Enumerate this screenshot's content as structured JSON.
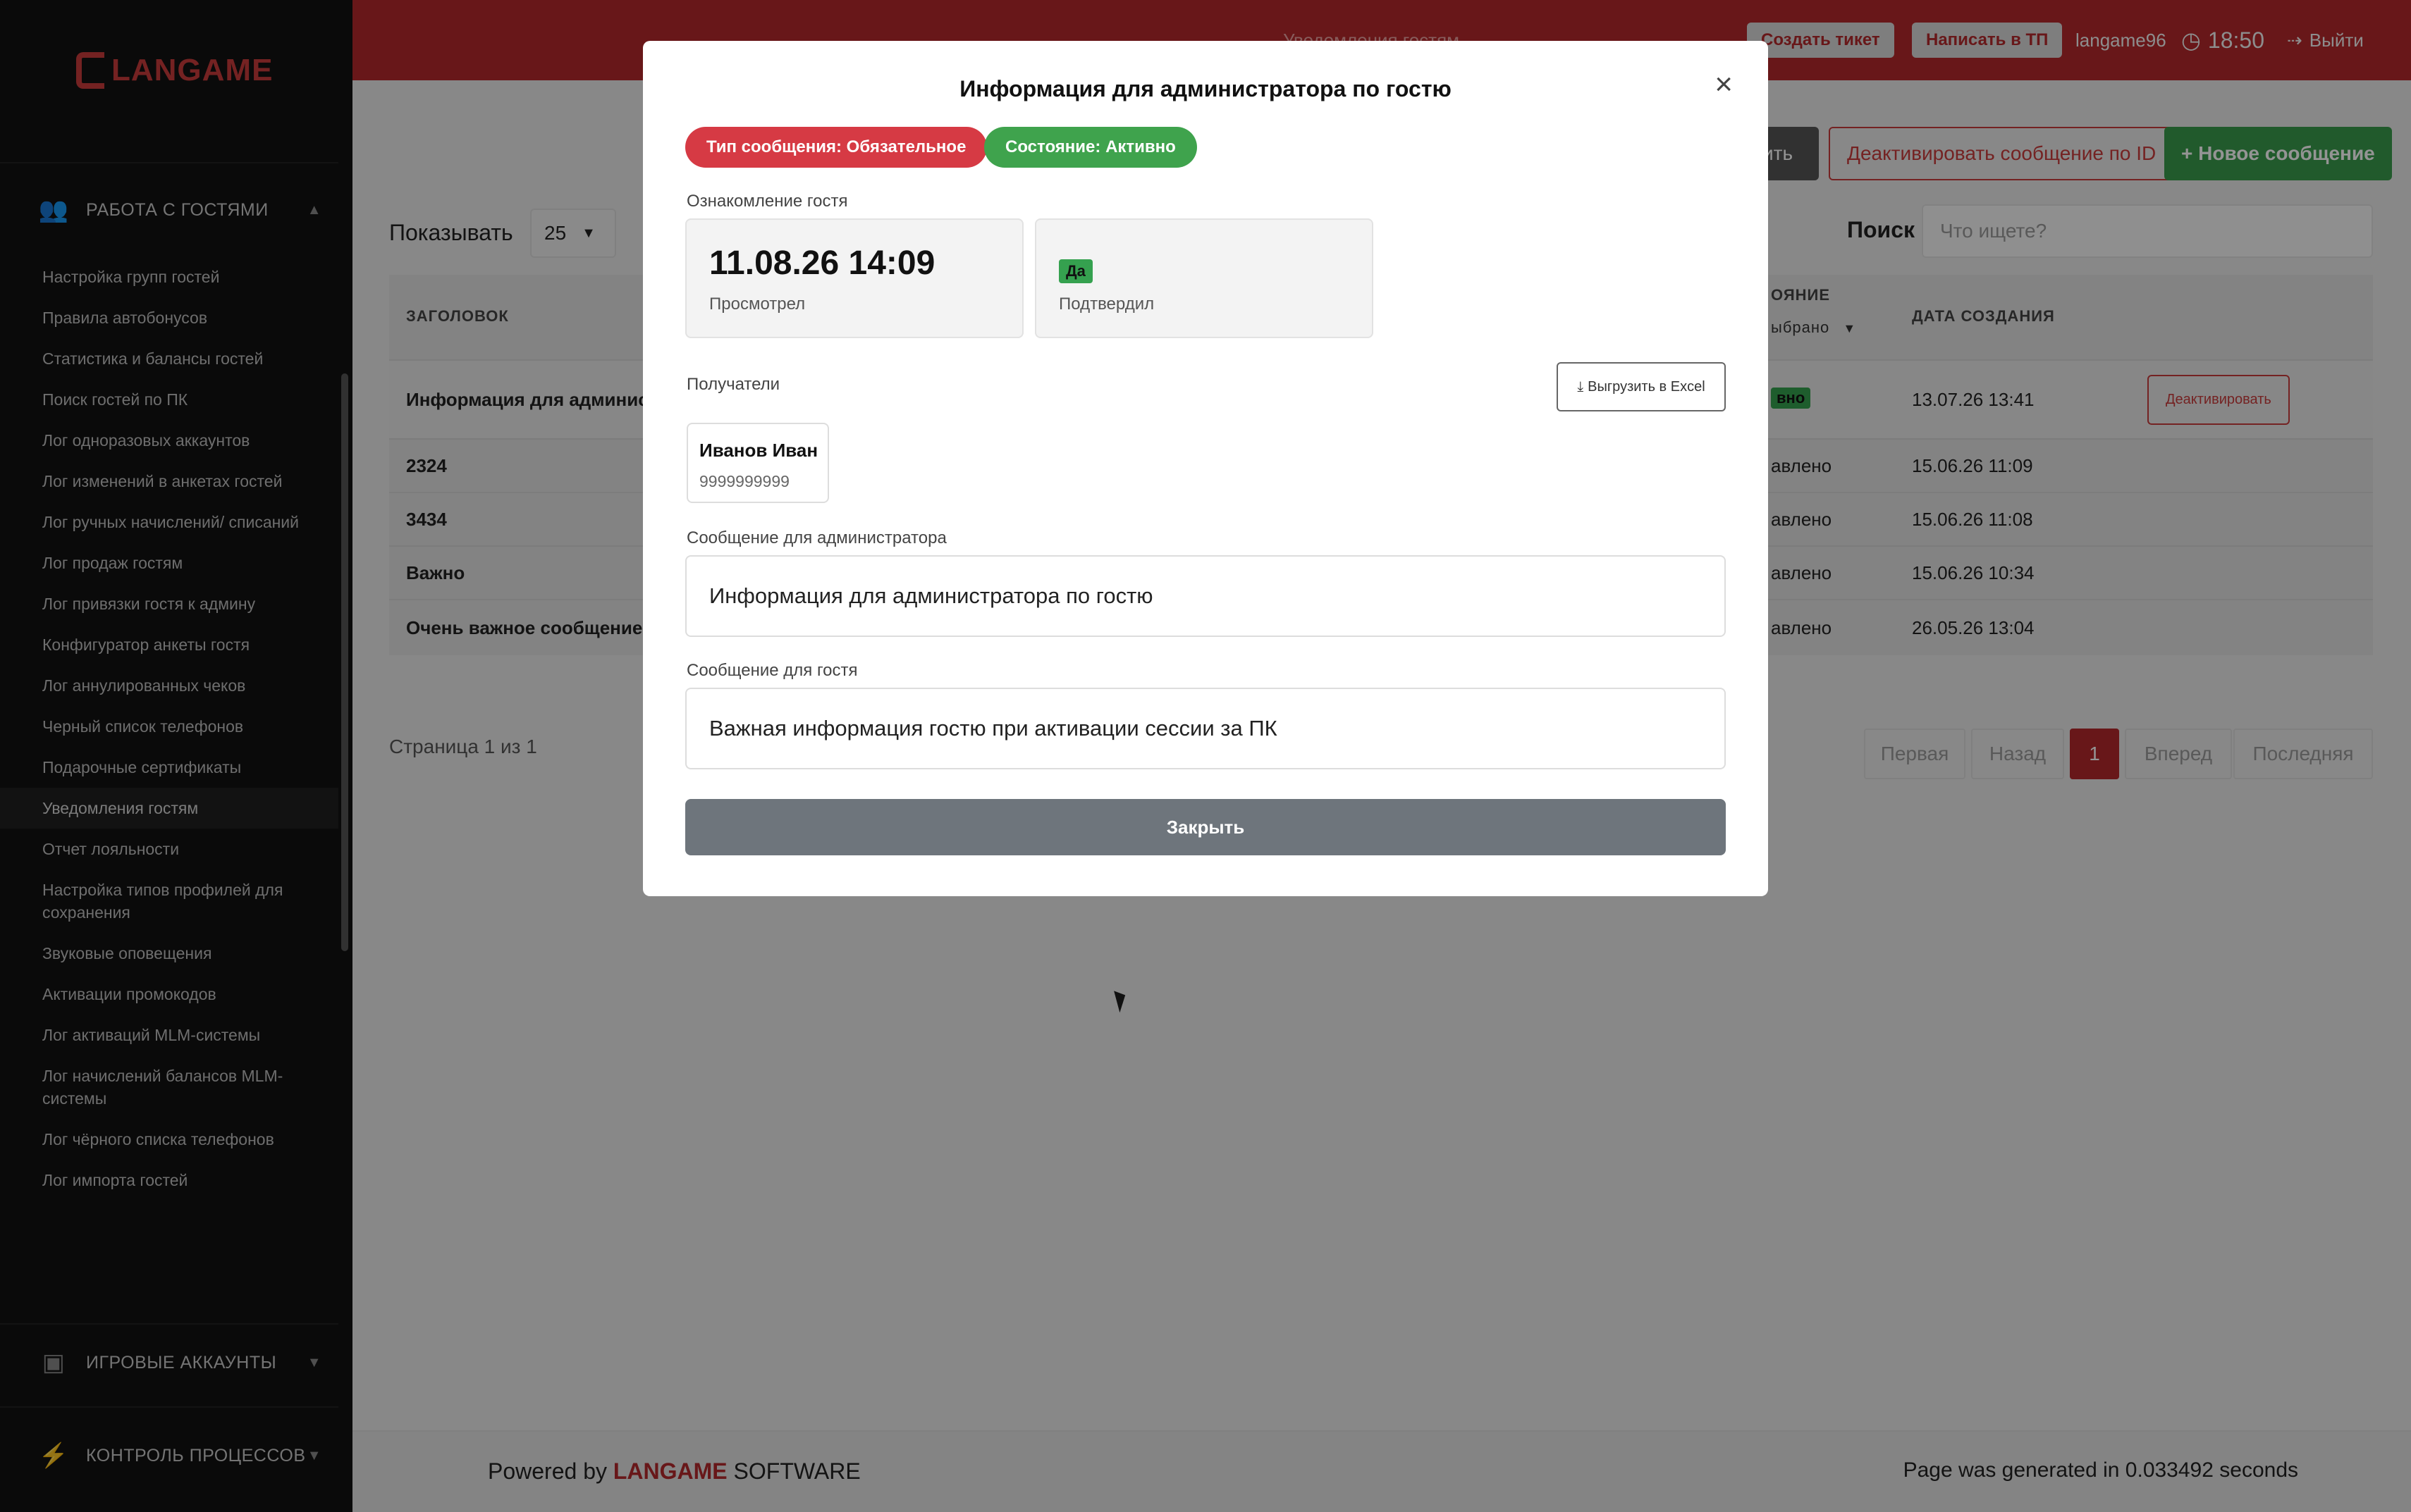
{
  "sidebar": {
    "logo": "LANGAME",
    "section_guests": "РАБОТА С ГОСТЯМИ",
    "items": [
      "Настройка групп гостей",
      "Правила автобонусов",
      "Статистика и балансы гостей",
      "Поиск гостей по ПК",
      "Лог одноразовых аккаунтов",
      "Лог изменений в анкетах гостей",
      "Лог ручных начислений/ списаний",
      "Лог продаж гостям",
      "Лог привязки гостя к админу",
      "Конфигуратор анкеты гостя",
      "Лог аннулированных чеков",
      "Черный список телефонов",
      "Подарочные сертификаты",
      "Уведомления гостям",
      "Отчет лояльности",
      "Настройка типов профилей для сохранения",
      "Звуковые оповещения",
      "Активации промокодов",
      "Лог активаций MLM-системы",
      "Лог начислений балансов MLM-системы",
      "Лог чёрного списка телефонов",
      "Лог импорта гостей"
    ],
    "active_item": "Уведомления гостям",
    "section_game_accounts": "ИГРОВЫЕ АККАУНТЫ",
    "section_processes": "КОНТРОЛЬ ПРОЦЕССОВ"
  },
  "header": {
    "page_title": "Уведомления гостям",
    "create_ticket": "Создать тикет",
    "write_support": "Написать в ТП",
    "username": "langame96",
    "time": "18:50",
    "logout": "Выйти"
  },
  "toolbar": {
    "hidden_btn": "ить",
    "deactivate_by_id": "Деактивировать сообщение по ID",
    "new_message": "+ Новое сообщение"
  },
  "list": {
    "show_label": "Показывать",
    "page_size": "25",
    "search_label": "Поиск",
    "search_placeholder": "Что ищете?",
    "columns": {
      "title": "ЗАГОЛОВОК",
      "state": "ОЯНИЕ",
      "state_filter": "ыбрано",
      "created": "ДАТА СОЗДАНИЯ"
    },
    "rows": [
      {
        "title": "Информация для администр",
        "state": "вно",
        "created": "13.07.26 13:41",
        "action": "Деактивировать"
      },
      {
        "title": "2324",
        "state": "авлено",
        "created": "15.06.26 11:09"
      },
      {
        "title": "3434",
        "state": "авлено",
        "created": "15.06.26 11:08"
      },
      {
        "title": "Важно",
        "state": "авлено",
        "created": "15.06.26 10:34"
      },
      {
        "title": "Очень важное сообщение",
        "state": "авлено",
        "created": "26.05.26 13:04"
      }
    ],
    "page_info": "Страница 1 из 1",
    "pager": {
      "first": "Первая",
      "prev": "Назад",
      "current": "1",
      "next": "Вперед",
      "last": "Последняя"
    }
  },
  "footer": {
    "powered_by": "Powered by",
    "brand": "LANGAME",
    "software": "SOFTWARE",
    "generated": "Page was generated in 0.033492 seconds"
  },
  "modal": {
    "title": "Информация для администратора по гостю",
    "badge_type": "Тип сообщения: Обязательное",
    "badge_state": "Состояние: Активно",
    "ack_label": "Ознакомление гостя",
    "viewed_date": "11.08.26 14:09",
    "viewed_label": "Просмотрел",
    "confirmed_value": "Да",
    "confirmed_label": "Подтвердил",
    "recipients_label": "Получатели",
    "export_btn": "Выгрузить в Excel",
    "recipient_name": "Иванов Иван",
    "recipient_phone": "9999999999",
    "admin_msg_label": "Сообщение для администратора",
    "admin_msg": "Информация для администратора по гостю",
    "guest_msg_label": "Сообщение для гостя",
    "guest_msg": "Важная информация гостю при активации сессии за ПК",
    "close_btn": "Закрыть"
  },
  "colors": {
    "brand_red": "#b4292b",
    "green": "#35a14f",
    "close_gray": "#6e757c"
  }
}
